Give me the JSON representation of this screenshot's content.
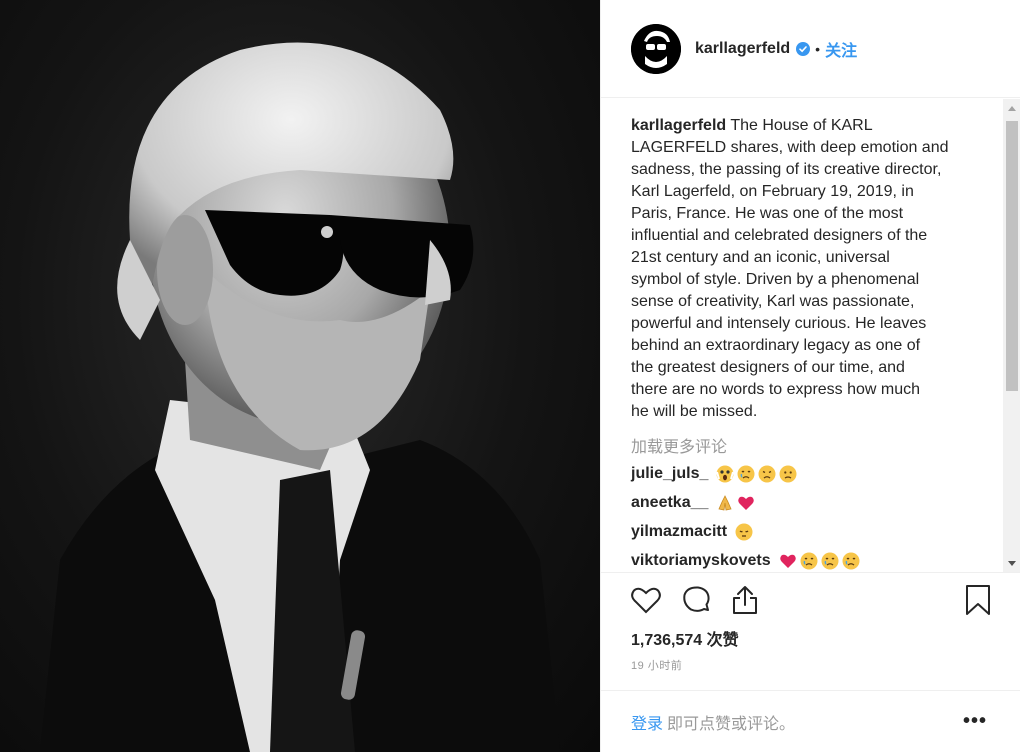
{
  "post": {
    "username": "karllagerfeld",
    "separator": "•",
    "follow_label": "关注",
    "caption_username": "karllagerfeld",
    "caption_lines": [
      " The House of KARL",
      "LAGERFELD shares, with deep emotion and",
      "sadness, the passing of its creative director,",
      "Karl Lagerfeld, on February 19, 2019, in",
      "Paris, France. He was one of the most",
      "influential and celebrated designers of the",
      "21st century and an iconic, universal",
      "symbol of style. Driven by a phenomenal",
      "sense of creativity, Karl was passionate,",
      "powerful and intensely curious. He leaves",
      "behind an extraordinary legacy as one of",
      "the greatest designers of our time, and",
      "there are no words to express how much",
      "he will be missed."
    ],
    "load_more": "加载更多评论",
    "comments": [
      {
        "user": "julie_juls_",
        "emojis": [
          "scream",
          "cry",
          "sad",
          "worried"
        ]
      },
      {
        "user": "aneetka__",
        "emojis": [
          "pray",
          "heart"
        ]
      },
      {
        "user": "yilmazmacitt",
        "emojis": [
          "pensive"
        ]
      },
      {
        "user": "viktoriamyskovets",
        "emojis": [
          "heart",
          "cry",
          "cry",
          "cry"
        ]
      }
    ],
    "likes": "1,736,574 次赞",
    "time_ago": "19 小时前",
    "login_label": "登录",
    "login_tail": "即可点赞或评论。",
    "more_label": "•••",
    "icons": {
      "like": "heart-outline-icon",
      "comment": "speech-bubble-icon",
      "share": "share-icon",
      "save": "bookmark-icon",
      "verified": "verified-badge-icon"
    },
    "colors": {
      "link": "#3897f0",
      "text": "#262626",
      "muted": "#999999",
      "verified": "#3897f0"
    }
  }
}
